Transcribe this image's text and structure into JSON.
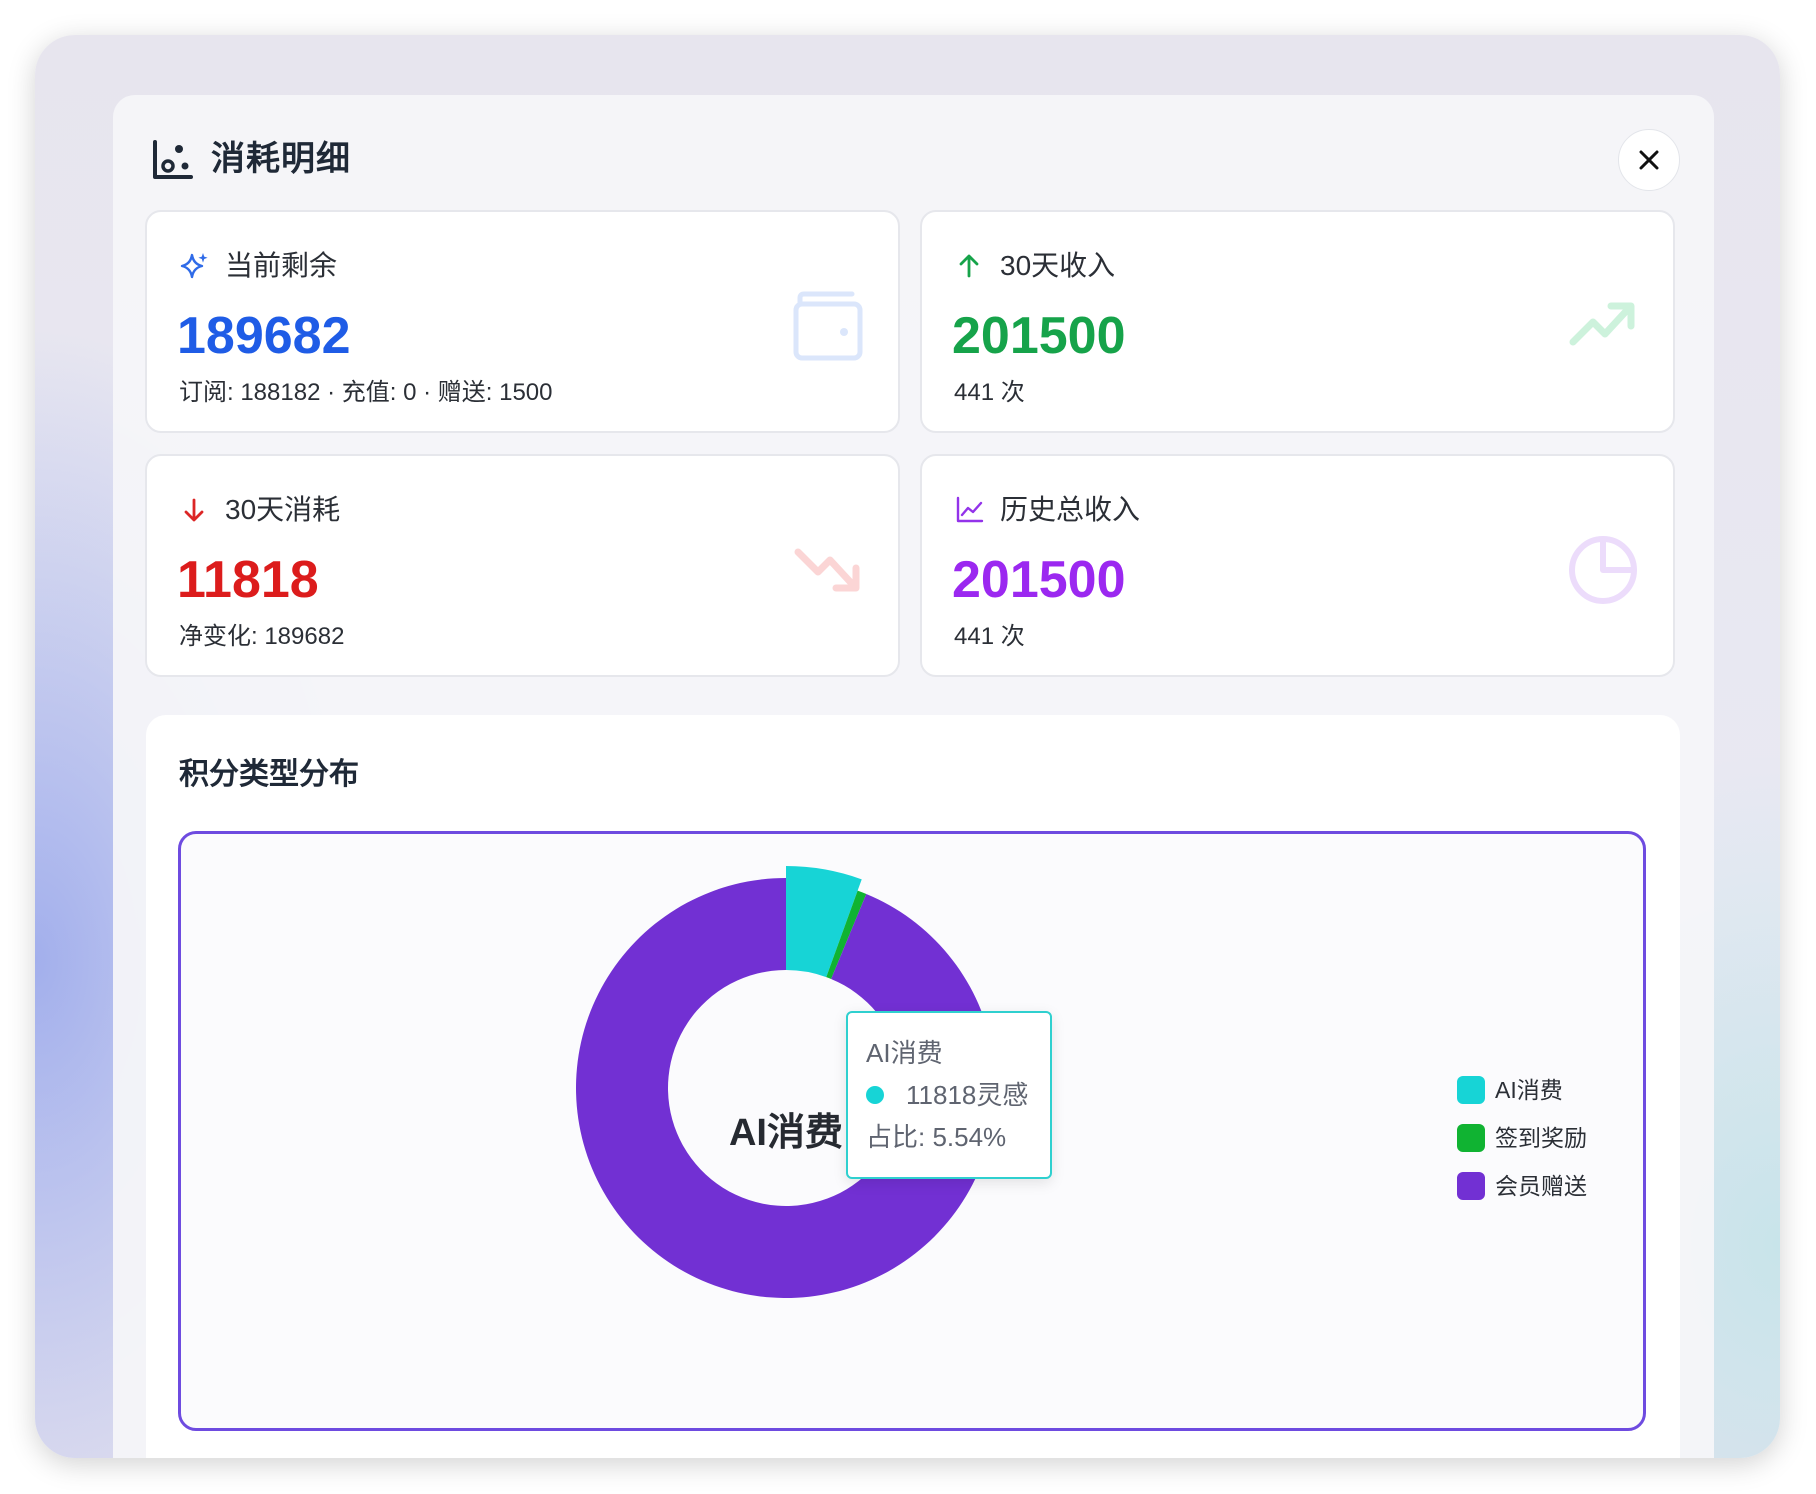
{
  "dialog": {
    "title": "消耗明细",
    "header_icon": "chart-scatter-icon",
    "close_icon": "close-icon"
  },
  "cards": [
    {
      "label": "当前剩余",
      "value": "189682",
      "sub": "订阅: 188182 · 充值: 0 · 赠送: 1500",
      "label_icon": "sparkles-icon",
      "deco_icon": "wallet-icon",
      "color": "#1f5ce6"
    },
    {
      "label": "30天收入",
      "value": "201500",
      "sub": "441 次",
      "label_icon": "arrow-up-icon",
      "deco_icon": "trending-up-icon",
      "color": "#16a34a"
    },
    {
      "label": "30天消耗",
      "value": "11818",
      "sub": "净变化: 189682",
      "label_icon": "arrow-down-icon",
      "deco_icon": "trending-down-icon",
      "color": "#dc1c1c"
    },
    {
      "label": "历史总收入",
      "value": "201500",
      "sub": "441 次",
      "label_icon": "line-chart-icon",
      "deco_icon": "pie-chart-icon",
      "color": "#9b28f0"
    }
  ],
  "distribution": {
    "title": "积分类型分布",
    "center_label": "AI消费",
    "tooltip": {
      "title": "AI消费",
      "value": "11818灵感",
      "share": "占比: 5.54%"
    }
  },
  "chart_data": {
    "type": "pie",
    "title": "积分类型分布",
    "categories": [
      "AI消费",
      "签到奖励",
      "会员赠送"
    ],
    "values": [
      11818,
      1500,
      200000
    ],
    "colors": [
      "#17d4d6",
      "#10b332",
      "#7230d3"
    ],
    "legend": "right",
    "highlighted": "AI消费"
  }
}
